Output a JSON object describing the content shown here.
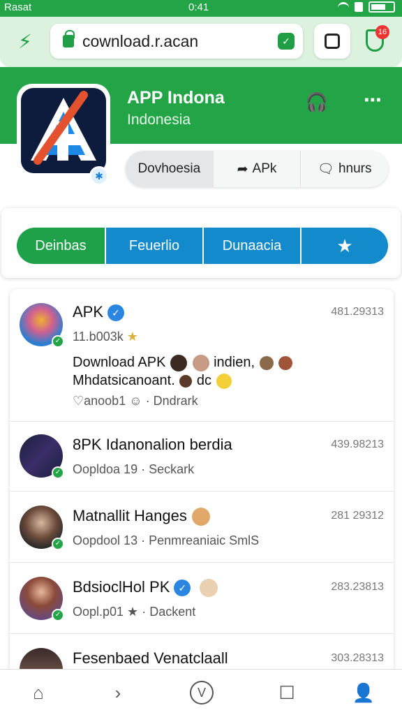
{
  "statusbar": {
    "carrier": "Rasat",
    "time": "0:41"
  },
  "browser": {
    "url": "cownload.r.acan",
    "badge_icon": "shield-check-icon",
    "notif_count": "16"
  },
  "app": {
    "title": "APP Indona",
    "subtitle": "Indonesia"
  },
  "actions": [
    {
      "label": "Dovhoesia",
      "icon": ""
    },
    {
      "label": "APk",
      "icon": "share-arrow-icon"
    },
    {
      "label": "hnurs",
      "icon": "comment-icon"
    }
  ],
  "filters": [
    {
      "label": "Deinbas",
      "color": "#1fa149"
    },
    {
      "label": "Feuerlio",
      "color": "#128acb"
    },
    {
      "label": "Dunaacia",
      "color": "#128acb"
    },
    {
      "label": "★",
      "color": "#128acb"
    }
  ],
  "rows": [
    {
      "title": "APK",
      "date": "481.29313",
      "sub": "11.b003k",
      "body1": "Download APK",
      "body1_tail": "indien,",
      "body2": "Mhdatsicanoant.",
      "body2_tail": "dc",
      "meta": "♡anoob1 ☺ · Dndrark"
    },
    {
      "title": "8PK Idanonalion berdia",
      "date": "439.98213",
      "meta": "Oopldoa 19 · Seckark"
    },
    {
      "title": "Matnallit Hanges",
      "date": "281 29312",
      "meta": "Oopdool 13 · Penmreaniaic SmlS"
    },
    {
      "title": "BdsioclHol PK",
      "date": "283.23813",
      "meta": "Oopl.p01 ★ · Dackent"
    },
    {
      "title": "Fesenbaed Venatclaall",
      "date": "303.28313"
    }
  ]
}
